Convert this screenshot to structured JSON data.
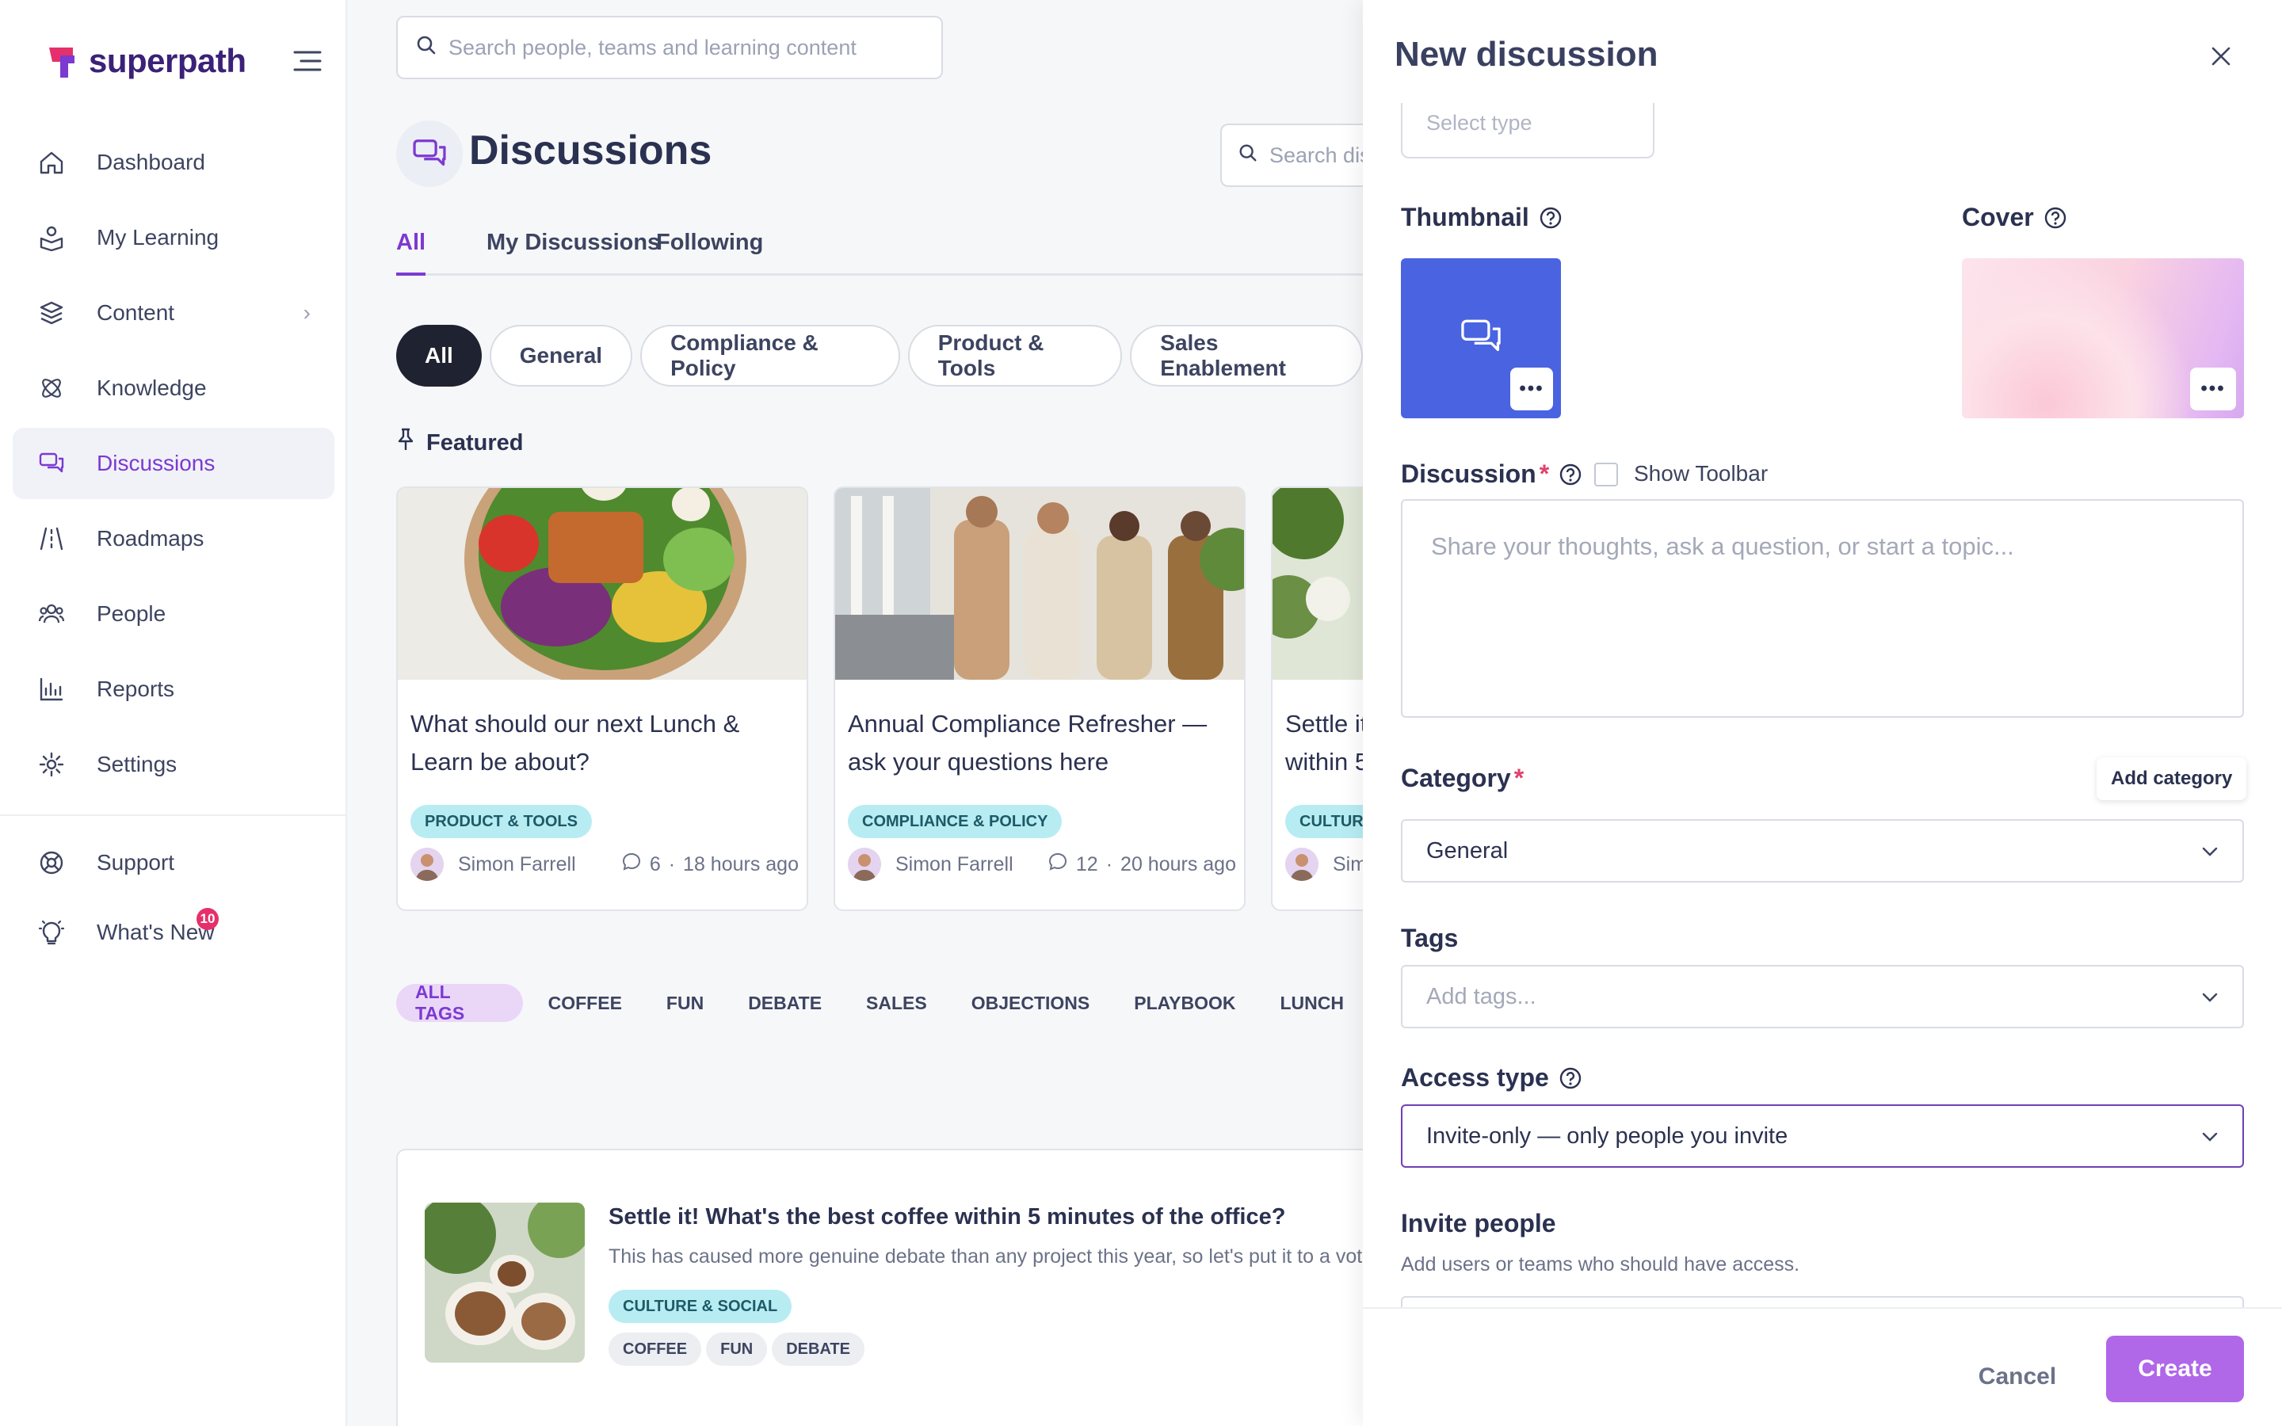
{
  "app": {
    "brand": "superpath",
    "brand_color": "#7c3ad1"
  },
  "search": {
    "placeholder": "Search people, teams and learning content"
  },
  "sidebar": {
    "items": [
      {
        "label": "Dashboard",
        "icon": "home-icon"
      },
      {
        "label": "My Learning",
        "icon": "learning-icon"
      },
      {
        "label": "Content",
        "icon": "layers-icon"
      },
      {
        "label": "Knowledge",
        "icon": "atom-icon"
      },
      {
        "label": "Discussions",
        "icon": "chat-icon",
        "active": true
      },
      {
        "label": "Roadmaps",
        "icon": "road-icon"
      },
      {
        "label": "People",
        "icon": "people-icon"
      },
      {
        "label": "Reports",
        "icon": "chart-icon"
      },
      {
        "label": "Settings",
        "icon": "gear-icon"
      }
    ],
    "support": {
      "label": "Support",
      "icon": "lifebuoy-icon"
    },
    "whats_new": {
      "label": "What's New",
      "icon": "bulb-icon",
      "badge": "10"
    }
  },
  "main": {
    "title": "Discussions",
    "search_placeholder": "Search discussions",
    "tabs": [
      {
        "label": "All"
      },
      {
        "label": "My Discussions"
      },
      {
        "label": "Following"
      }
    ],
    "filters": [
      "All",
      "General",
      "Compliance & Policy",
      "Product & Tools",
      "Sales Enablement"
    ],
    "featured_label": "Featured",
    "cards": [
      {
        "title": "What should our next Lunch & Learn be about?",
        "tag": "PRODUCT & TOOLS",
        "author": "Simon Farrell",
        "comments": "6",
        "time": "18 hours ago"
      },
      {
        "title": "Annual Compliance Refresher — ask your questions here",
        "tag": "COMPLIANCE & POLICY",
        "author": "Simon Farrell",
        "comments": "12",
        "time": "20 hours ago"
      },
      {
        "title": "Settle it! What's the best coffee within 5 minutes of the office?",
        "tag": "CULTURE & SOCIAL",
        "author": "Simon Farrell"
      }
    ],
    "tags": [
      "ALL TAGS",
      "COFFEE",
      "FUN",
      "DEBATE",
      "SALES",
      "OBJECTIONS",
      "PLAYBOOK",
      "LUNCH"
    ],
    "list_item": {
      "title": "Settle it! What's the best coffee within 5 minutes of the office?",
      "desc": "This has caused more genuine debate than any project this year, so let's put it to a vote.",
      "tag": "CULTURE & SOCIAL",
      "mini_tags": [
        "COFFEE",
        "FUN",
        "DEBATE"
      ]
    }
  },
  "panel": {
    "title": "New discussion",
    "select_type_placeholder": "Select type",
    "thumbnail_label": "Thumbnail",
    "cover_label": "Cover",
    "discussion_label": "Discussion",
    "show_toolbar": "Show Toolbar",
    "discussion_placeholder": "Share your thoughts, ask a question, or start a topic...",
    "category_label": "Category",
    "add_category": "Add category",
    "category_value": "General",
    "tags_label": "Tags",
    "tags_placeholder": "Add tags...",
    "access_label": "Access type",
    "access_value": "Invite-only — only people you invite",
    "invite_label": "Invite people",
    "invite_sub": "Add users or teams who should have access.",
    "cancel": "Cancel",
    "create": "Create"
  }
}
